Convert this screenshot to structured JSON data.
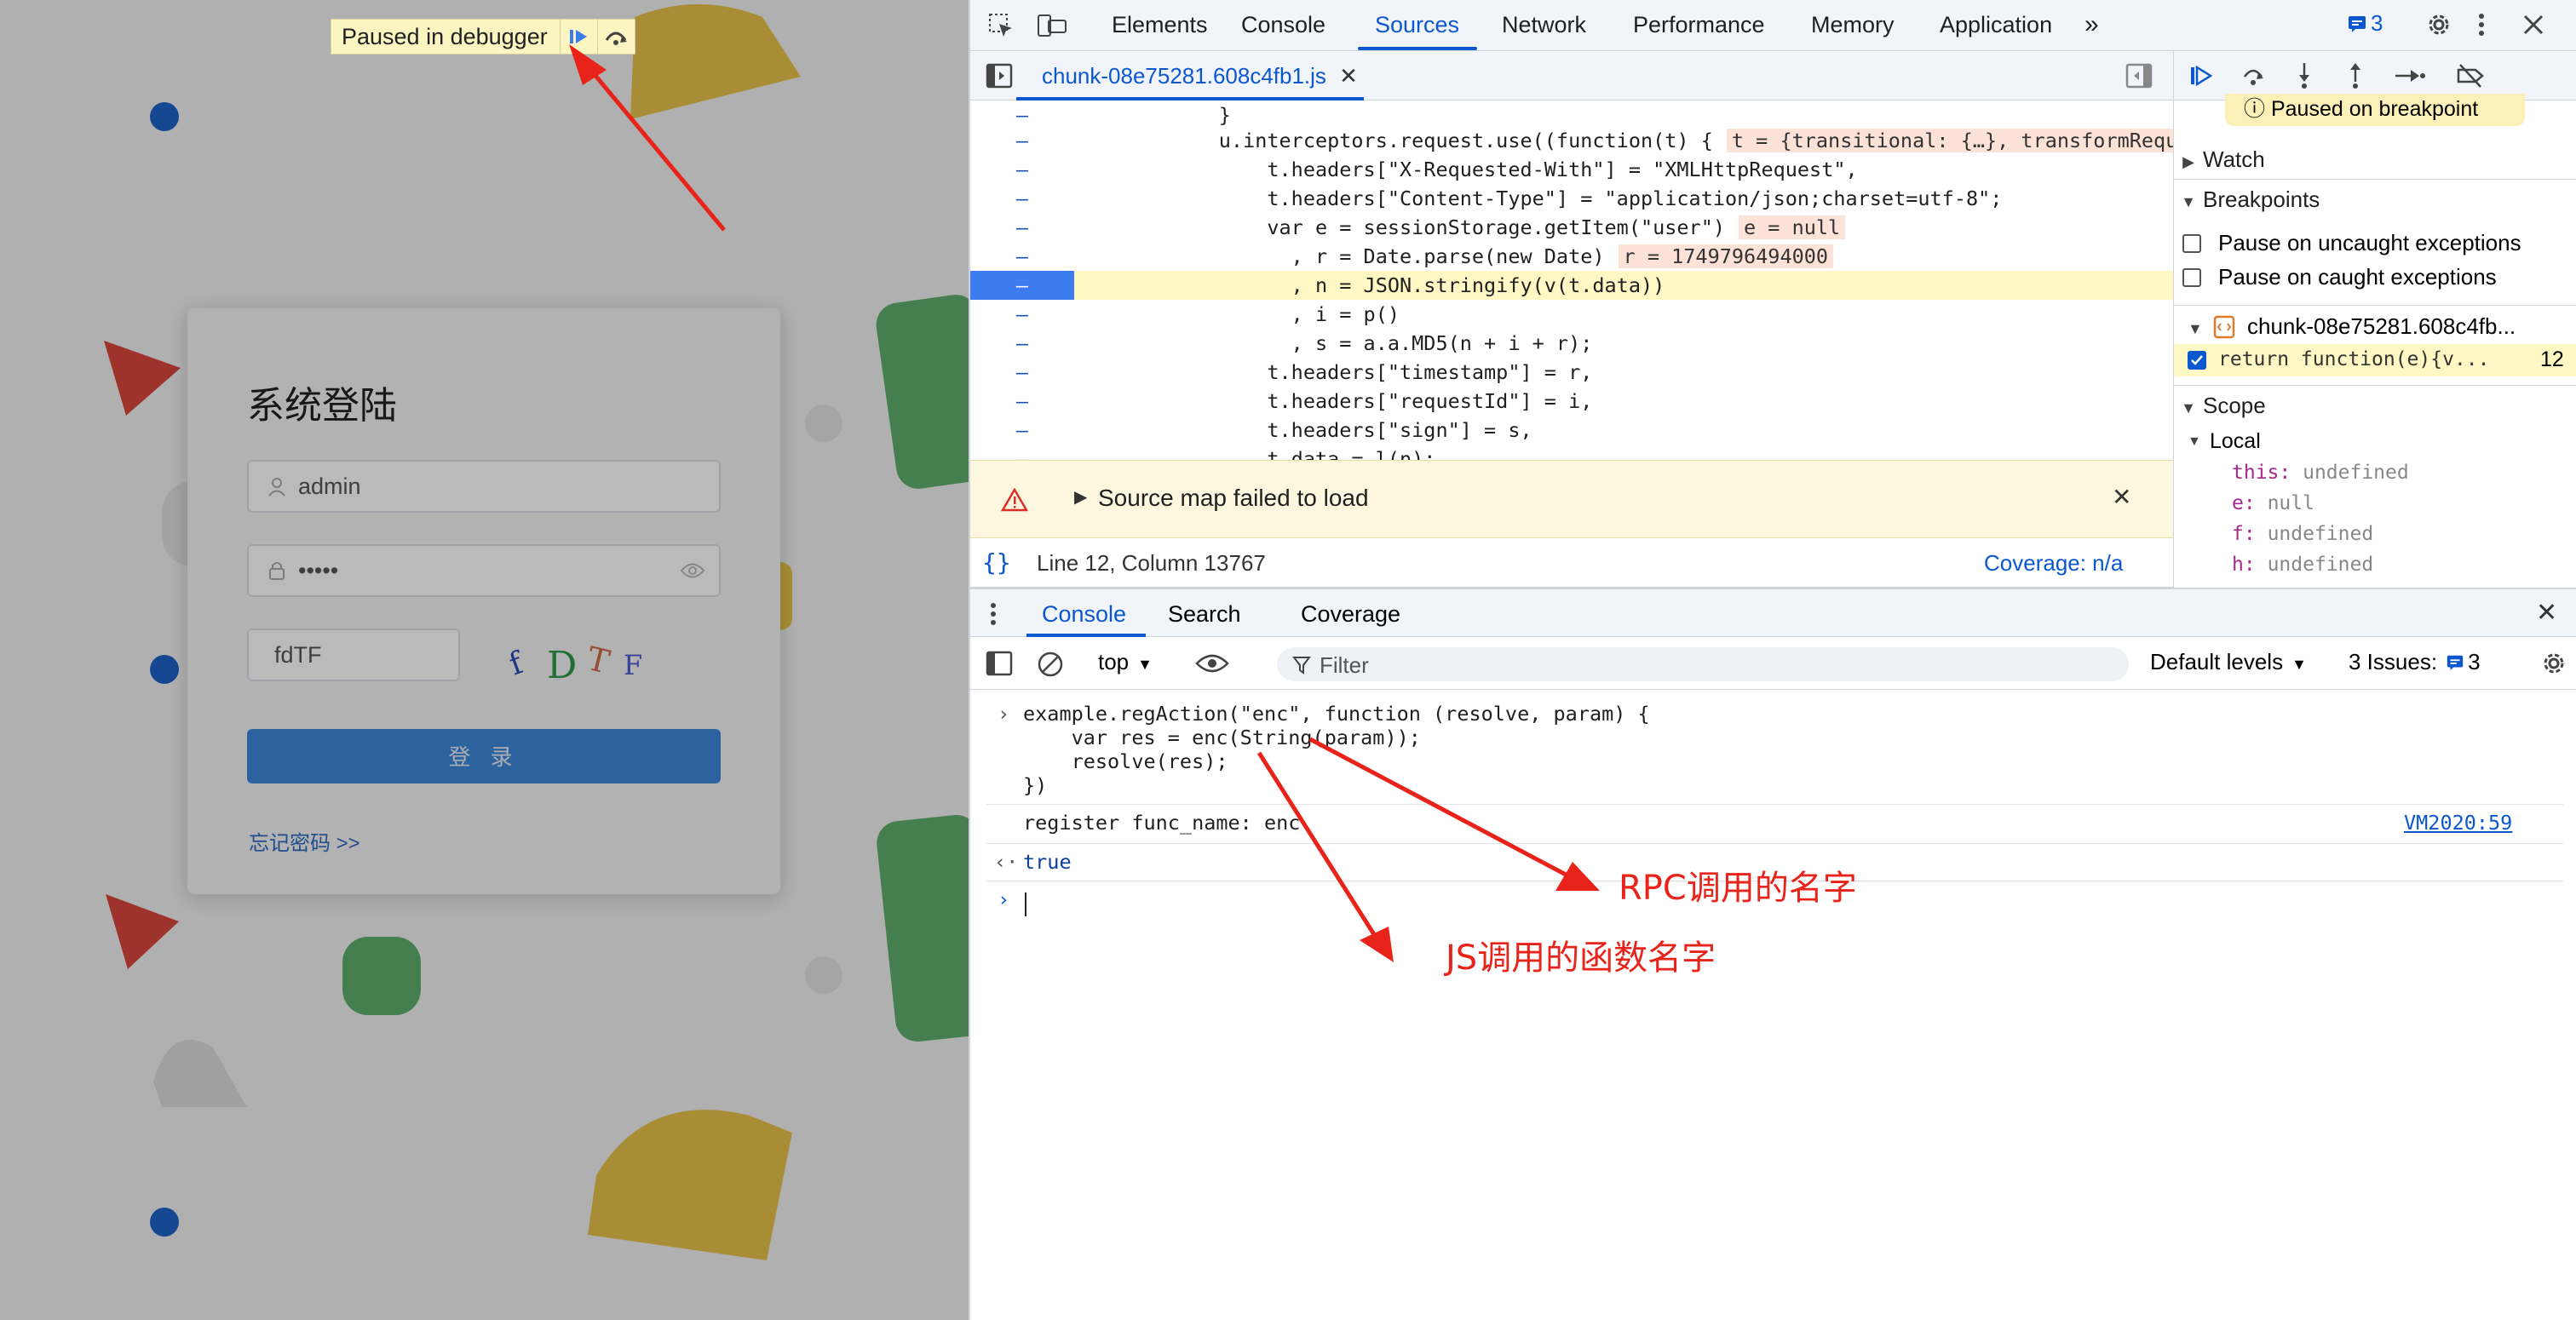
{
  "debugger_overlay": {
    "paused_text": "Paused in debugger"
  },
  "login": {
    "title": "系统登陆",
    "username_value": "admin",
    "password_value": "•••••",
    "captcha_value": "fdTF",
    "captcha_chars": [
      "f",
      "D",
      "T",
      "F"
    ],
    "login_button": "登 录",
    "forgot_link": "忘记密码 >>"
  },
  "devtools": {
    "tabs": [
      "Elements",
      "Console",
      "Sources",
      "Network",
      "Performance",
      "Memory",
      "Application"
    ],
    "active_tab": "Sources",
    "issues_badge": "3",
    "editor": {
      "file_tab": "chunk-08e75281.608c4fb1.js",
      "gutter_marker": "–",
      "code_lines": [
        {
          "code": "            }"
        },
        {
          "code": "            u.interceptors.request.use((function(t) {",
          "ann": "t = {transitional: {…}, transformRequ"
        },
        {
          "code": "                t.headers[\"X-Requested-With\"] = \"XMLHttpRequest\","
        },
        {
          "code": "                t.headers[\"Content-Type\"] = \"application/json;charset=utf-8\";"
        },
        {
          "code": "                var e = sessionStorage.getItem(\"user\")",
          "ann": "e = null"
        },
        {
          "code": "                  , r = Date.parse(new Date)",
          "ann": "r = 1749796494000"
        },
        {
          "code": "                  , n = JSON.stringify(v(t.data))",
          "highlight": true
        },
        {
          "code": "                  , i = p()"
        },
        {
          "code": "                  , s = a.a.MD5(n + i + r);"
        },
        {
          "code": "                t.headers[\"timestamp\"] = r,"
        },
        {
          "code": "                t.headers[\"requestId\"] = i,"
        },
        {
          "code": "                t.headers[\"sign\"] = s,"
        },
        {
          "code": "                t.data = l(n);"
        }
      ],
      "warning": "Source map failed to load",
      "status_position": "Line 12, Column 13767",
      "coverage": "Coverage: n/a"
    },
    "sidebar": {
      "paused_on": "Paused on breakpoint",
      "watch": "Watch",
      "breakpoints": "Breakpoints",
      "pause_uncaught": "Pause on uncaught exceptions",
      "pause_caught": "Pause on caught exceptions",
      "bp_file": "chunk-08e75281.608c4fb...",
      "bp_line_code": "return function(e){v...",
      "bp_line_no": "12",
      "scope": "Scope",
      "local": "Local",
      "scope_vars": [
        {
          "name": "this",
          "value": "undefined"
        },
        {
          "name": "e",
          "value": "null"
        },
        {
          "name": "f",
          "value": "undefined"
        },
        {
          "name": "h",
          "value": "undefined"
        }
      ]
    },
    "drawer": {
      "tabs": [
        "Console",
        "Search",
        "Coverage"
      ],
      "context": "top",
      "filter_placeholder": "Filter",
      "levels": "Default levels",
      "issues_label": "3 Issues:",
      "issues_count": "3",
      "input_lines": [
        "example.regAction(\"enc\", function (resolve, param) {",
        "    var res = enc(String(param));",
        "    resolve(res);",
        "})"
      ],
      "log_message": "register func_name: enc",
      "log_source": "VM2020:59",
      "return_value": "true"
    }
  },
  "annotations": {
    "rpc_label": "RPC调用的名字",
    "js_label": "JS调用的函数名字",
    "arrow_color": "#e8231a"
  }
}
